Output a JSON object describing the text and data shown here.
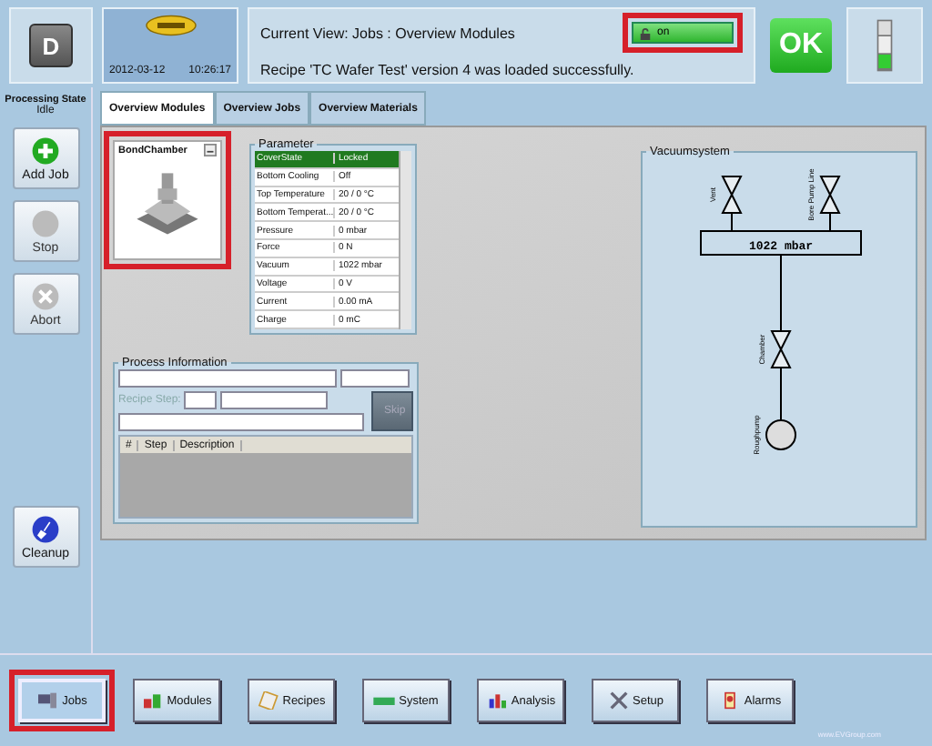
{
  "header": {
    "mode_key": "D",
    "date": "2012-03-12",
    "time": "10:26:17",
    "current_view": "Current View: Jobs : Overview Modules",
    "message": "Recipe 'TC Wafer Test' version 4 was loaded successfully.",
    "lock_button": {
      "label": "on",
      "highlighted": true
    },
    "status": "OK"
  },
  "processing_state": {
    "label": "Processing State",
    "value": "Idle"
  },
  "side_buttons": [
    {
      "kind": "add",
      "label": "Add Job",
      "disabled": false
    },
    {
      "kind": "stop",
      "label": "Stop",
      "disabled": true
    },
    {
      "kind": "abort",
      "label": "Abort",
      "disabled": true
    },
    {
      "kind": "cleanup",
      "label": "Cleanup",
      "disabled": false
    }
  ],
  "tabs": [
    {
      "label": "Overview Modules",
      "selected": true
    },
    {
      "label": "Overview Jobs",
      "selected": false
    },
    {
      "label": "Overview Materials",
      "selected": false
    }
  ],
  "module_card": {
    "title": "BondChamber",
    "highlighted": true
  },
  "parameter": {
    "title": "Parameter",
    "rows": [
      {
        "name": "CoverState",
        "value": "Locked",
        "selected": true
      },
      {
        "name": "Bottom Cooling",
        "value": "Off",
        "selected": false
      },
      {
        "name": "Top Temperature",
        "value": "20 / 0 °C",
        "selected": false
      },
      {
        "name": "Bottom Temperat...",
        "value": "20 / 0 °C",
        "selected": false
      },
      {
        "name": "Pressure",
        "value": "0 mbar",
        "selected": false
      },
      {
        "name": "Force",
        "value": "0 N",
        "selected": false
      },
      {
        "name": "Vacuum",
        "value": "1022 mbar",
        "selected": false
      },
      {
        "name": "Voltage",
        "value": "0 V",
        "selected": false
      },
      {
        "name": "Current",
        "value": "0.00 mA",
        "selected": false
      },
      {
        "name": "Charge",
        "value": "0 mC",
        "selected": false
      }
    ]
  },
  "process_information": {
    "title": "Process Information",
    "recipe_step_label": "Recipe Step:",
    "skip_button": "Skip",
    "columns": [
      "#",
      "Step",
      "Description"
    ]
  },
  "vacuumsystem": {
    "title": "Vacuumsystem",
    "valves": [
      "Vent",
      "Bore Pump Line"
    ],
    "reading": "1022 mbar",
    "chamber_valve": "Chamber",
    "pump": "Roughpump"
  },
  "nav_buttons": [
    {
      "kind": "jobs",
      "label": "Jobs",
      "selected": true,
      "highlighted": true
    },
    {
      "kind": "modules",
      "label": "Modules",
      "selected": false,
      "highlighted": false
    },
    {
      "kind": "recipes",
      "label": "Recipes",
      "selected": false,
      "highlighted": false
    },
    {
      "kind": "system",
      "label": "System",
      "selected": false,
      "highlighted": false
    },
    {
      "kind": "analysis",
      "label": "Analysis",
      "selected": false,
      "highlighted": false
    },
    {
      "kind": "setup",
      "label": "Setup",
      "selected": false,
      "highlighted": false
    },
    {
      "kind": "alarms",
      "label": "Alarms",
      "selected": false,
      "highlighted": false
    }
  ],
  "footer": "www.EVGroup.com"
}
